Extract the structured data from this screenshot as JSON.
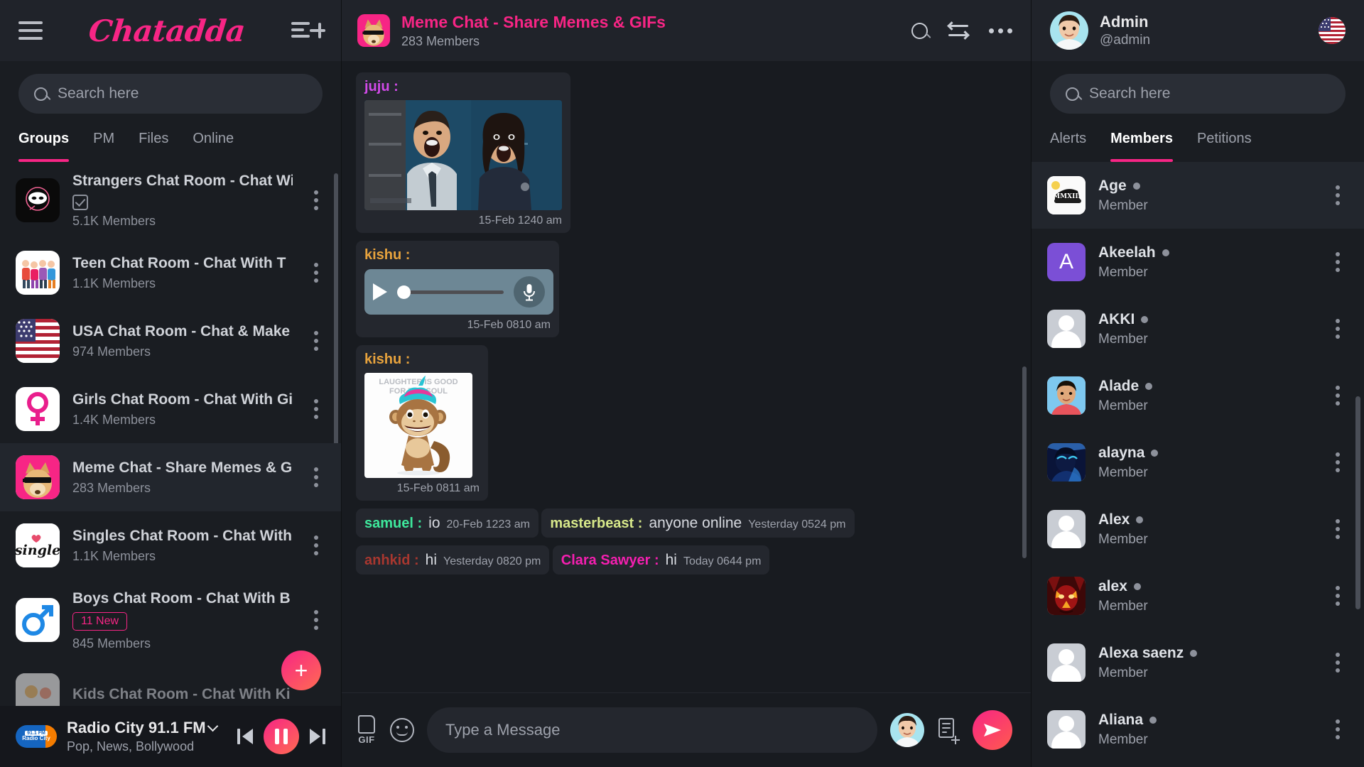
{
  "brand": {
    "name": "Chatadda",
    "accent": "#f72585"
  },
  "sidebar": {
    "search_placeholder": "Search here",
    "tabs": [
      {
        "label": "Groups",
        "active": true
      },
      {
        "label": "PM",
        "active": false
      },
      {
        "label": "Files",
        "active": false
      },
      {
        "label": "Online",
        "active": false
      }
    ],
    "groups": [
      {
        "name": "Strangers Chat Room - Chat Wi",
        "members": "5.1K Members",
        "avatar": "masked-face-icon",
        "has_check": true,
        "badge": null,
        "active": false
      },
      {
        "name": "Teen Chat Room - Chat With T",
        "members": "1.1K Members",
        "avatar": "teens-group-icon",
        "has_check": false,
        "badge": null,
        "active": false
      },
      {
        "name": "USA Chat Room - Chat & Make",
        "members": "974 Members",
        "avatar": "usa-flag-icon",
        "has_check": false,
        "badge": null,
        "active": false
      },
      {
        "name": "Girls Chat Room - Chat With Gi",
        "members": "1.4K Members",
        "avatar": "female-symbol-icon",
        "has_check": false,
        "badge": null,
        "active": false
      },
      {
        "name": "Meme Chat - Share Memes & G",
        "members": "283 Members",
        "avatar": "doge-icon",
        "has_check": false,
        "badge": null,
        "active": true
      },
      {
        "name": "Singles Chat Room - Chat With",
        "members": "1.1K Members",
        "avatar": "single-text-icon",
        "has_check": false,
        "badge": null,
        "active": false
      },
      {
        "name": "Boys Chat Room - Chat With B",
        "members": "845 Members",
        "avatar": "male-symbol-icon",
        "has_check": false,
        "badge": "11 New",
        "active": false
      },
      {
        "name": "Kids Chat Room - Chat With Ki",
        "members": "",
        "avatar": "kids-icon",
        "has_check": false,
        "badge": null,
        "active": false
      }
    ],
    "add_button_label": "+",
    "player": {
      "station": "Radio City 91.1 FM",
      "genres": "Pop, News, Bollywood",
      "logo_line1": "91.1 FM",
      "logo_line2": "Radio City"
    }
  },
  "chat": {
    "title": "Meme Chat - Share Memes & GIFs",
    "members": "283 Members",
    "messages": [
      {
        "sender": "juju :",
        "color": "#d14ae8",
        "type": "image",
        "image": "shocked-couple-gif",
        "timestamp": "15-Feb 1240 am"
      },
      {
        "sender": "kishu :",
        "color": "#e8a33d",
        "type": "audio",
        "timestamp": "15-Feb 0810 am"
      },
      {
        "sender": "kishu :",
        "color": "#e8a33d",
        "type": "image",
        "image": "laughing-monkey-meme",
        "image_caption": "LAUGHTER IS GOOD FOR THE SOUL",
        "timestamp": "15-Feb 0811 am"
      },
      {
        "sender": "samuel :",
        "color": "#3ee89c",
        "type": "text",
        "text": "io",
        "timestamp": "20-Feb 1223 am"
      },
      {
        "sender": "masterbeast :",
        "color": "#d7e88a",
        "type": "text",
        "text": "anyone online",
        "timestamp": "Yesterday 0524 pm"
      },
      {
        "sender": "anhkid :",
        "color": "#a8372f",
        "type": "text",
        "text": "hi",
        "timestamp": "Yesterday 0820 pm"
      },
      {
        "sender": "Clara Sawyer :",
        "color": "#f51fb0",
        "type": "text",
        "text": "hi",
        "timestamp": "Today 0644 pm"
      }
    ],
    "composer": {
      "placeholder": "Type a Message",
      "gif_label": "GIF"
    }
  },
  "right": {
    "user": {
      "name": "Admin",
      "handle": "@admin",
      "flag": "usa-flag-icon"
    },
    "search_placeholder": "Search here",
    "tabs": [
      {
        "label": "Alerts",
        "active": false
      },
      {
        "label": "Members",
        "active": true
      },
      {
        "label": "Petitions",
        "active": false
      }
    ],
    "members": [
      {
        "name": "Age",
        "role": "Member",
        "avatar": "cap-photo",
        "highlight": true
      },
      {
        "name": "Akeelah",
        "role": "Member",
        "avatar": "letter-a-purple",
        "highlight": false
      },
      {
        "name": "AKKI",
        "role": "Member",
        "avatar": "default-person",
        "highlight": false
      },
      {
        "name": "Alade",
        "role": "Member",
        "avatar": "man-photo",
        "highlight": false
      },
      {
        "name": "alayna",
        "role": "Member",
        "avatar": "anime-photo",
        "highlight": false
      },
      {
        "name": "Alex",
        "role": "Member",
        "avatar": "default-person",
        "highlight": false
      },
      {
        "name": "alex",
        "role": "Member",
        "avatar": "red-demon-photo",
        "highlight": false
      },
      {
        "name": "Alexa saenz",
        "role": "Member",
        "avatar": "default-person",
        "highlight": false
      },
      {
        "name": "Aliana",
        "role": "Member",
        "avatar": "default-person",
        "highlight": false
      }
    ]
  }
}
